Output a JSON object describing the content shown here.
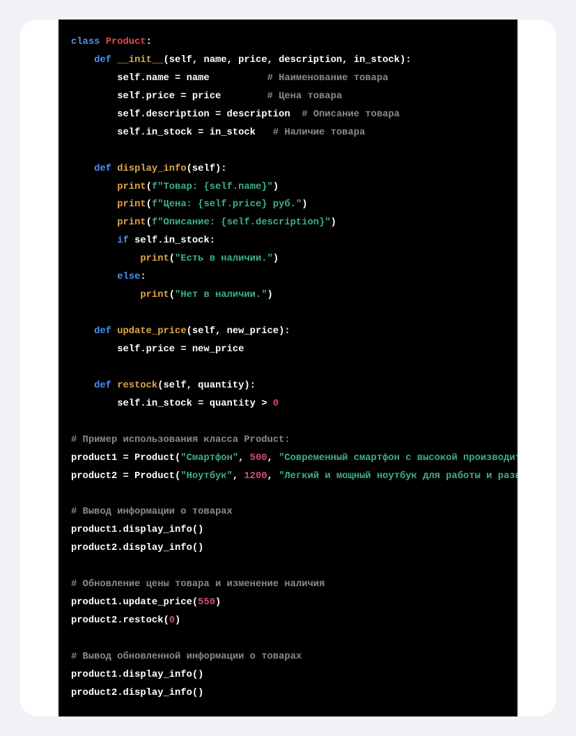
{
  "lines": [
    [
      [
        "kw",
        "class "
      ],
      [
        "cls",
        "Product"
      ],
      [
        "id",
        ":"
      ]
    ],
    [
      [
        "id",
        "    "
      ],
      [
        "kw",
        "def "
      ],
      [
        "fn",
        "__init__"
      ],
      [
        "id",
        "(self, name, price, description, in_stock):"
      ]
    ],
    [
      [
        "id",
        "        self.name = name          "
      ],
      [
        "cmt",
        "# Наименование товара"
      ]
    ],
    [
      [
        "id",
        "        self.price = price        "
      ],
      [
        "cmt",
        "# Цена товара"
      ]
    ],
    [
      [
        "id",
        "        self.description = description  "
      ],
      [
        "cmt",
        "# Описание товара"
      ]
    ],
    [
      [
        "id",
        "        self.in_stock = in_stock   "
      ],
      [
        "cmt",
        "# Наличие товара"
      ]
    ],
    [
      [
        "id",
        ""
      ]
    ],
    [
      [
        "id",
        "    "
      ],
      [
        "kw",
        "def "
      ],
      [
        "fn",
        "display_info"
      ],
      [
        "id",
        "(self):"
      ]
    ],
    [
      [
        "id",
        "        "
      ],
      [
        "pri",
        "print"
      ],
      [
        "id",
        "("
      ],
      [
        "str",
        "f\"Товар: {self.name}\""
      ],
      [
        "id",
        ")"
      ]
    ],
    [
      [
        "id",
        "        "
      ],
      [
        "pri",
        "print"
      ],
      [
        "id",
        "("
      ],
      [
        "str",
        "f\"Цена: {self.price} руб.\""
      ],
      [
        "id",
        ")"
      ]
    ],
    [
      [
        "id",
        "        "
      ],
      [
        "pri",
        "print"
      ],
      [
        "id",
        "("
      ],
      [
        "str",
        "f\"Описание: {self.description}\""
      ],
      [
        "id",
        ")"
      ]
    ],
    [
      [
        "id",
        "        "
      ],
      [
        "kw",
        "if"
      ],
      [
        "id",
        " self.in_stock:"
      ]
    ],
    [
      [
        "id",
        "            "
      ],
      [
        "pri",
        "print"
      ],
      [
        "id",
        "("
      ],
      [
        "str",
        "\"Есть в наличии.\""
      ],
      [
        "id",
        ")"
      ]
    ],
    [
      [
        "id",
        "        "
      ],
      [
        "kw",
        "else"
      ],
      [
        "id",
        ":"
      ]
    ],
    [
      [
        "id",
        "            "
      ],
      [
        "pri",
        "print"
      ],
      [
        "id",
        "("
      ],
      [
        "str",
        "\"Нет в наличии.\""
      ],
      [
        "id",
        ")"
      ]
    ],
    [
      [
        "id",
        ""
      ]
    ],
    [
      [
        "id",
        "    "
      ],
      [
        "kw",
        "def "
      ],
      [
        "fn",
        "update_price"
      ],
      [
        "id",
        "(self, new_price):"
      ]
    ],
    [
      [
        "id",
        "        self.price = new_price"
      ]
    ],
    [
      [
        "id",
        ""
      ]
    ],
    [
      [
        "id",
        "    "
      ],
      [
        "kw",
        "def "
      ],
      [
        "fn",
        "restock"
      ],
      [
        "id",
        "(self, quantity):"
      ]
    ],
    [
      [
        "id",
        "        self.in_stock = quantity > "
      ],
      [
        "num",
        "0"
      ]
    ],
    [
      [
        "id",
        ""
      ]
    ],
    [
      [
        "cmt",
        "# Пример использования класса Product:"
      ]
    ],
    [
      [
        "id",
        "product1 = Product("
      ],
      [
        "str",
        "\"Смартфон\""
      ],
      [
        "id",
        ", "
      ],
      [
        "num",
        "500"
      ],
      [
        "id",
        ", "
      ],
      [
        "str",
        "\"Современный смартфон с высокой производител"
      ]
    ],
    [
      [
        "id",
        "product2 = Product("
      ],
      [
        "str",
        "\"Ноутбук\""
      ],
      [
        "id",
        ", "
      ],
      [
        "num",
        "1200"
      ],
      [
        "id",
        ", "
      ],
      [
        "str",
        "\"Легкий и мощный ноутбук для работы и развл"
      ]
    ],
    [
      [
        "id",
        ""
      ]
    ],
    [
      [
        "cmt",
        "# Вывод информации о товарах"
      ]
    ],
    [
      [
        "id",
        "product1.display_info()"
      ]
    ],
    [
      [
        "id",
        "product2.display_info()"
      ]
    ],
    [
      [
        "id",
        ""
      ]
    ],
    [
      [
        "cmt",
        "# Обновление цены товара и изменение наличия"
      ]
    ],
    [
      [
        "id",
        "product1.update_price("
      ],
      [
        "num",
        "550"
      ],
      [
        "id",
        ")"
      ]
    ],
    [
      [
        "id",
        "product2.restock("
      ],
      [
        "num",
        "0"
      ],
      [
        "id",
        ")"
      ]
    ],
    [
      [
        "id",
        ""
      ]
    ],
    [
      [
        "cmt",
        "# Вывод обновленной информации о товарах"
      ]
    ],
    [
      [
        "id",
        "product1.display_info()"
      ]
    ],
    [
      [
        "id",
        "product2.display_info()"
      ]
    ]
  ]
}
